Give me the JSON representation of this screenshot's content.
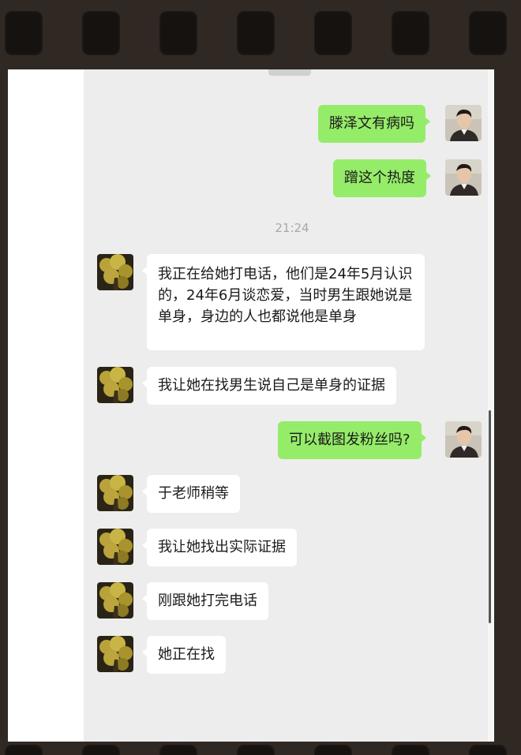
{
  "chat": {
    "timestamp": "21:24",
    "messages": [
      {
        "side": "out",
        "text": "滕泽文有病吗"
      },
      {
        "side": "out",
        "text": "蹭这个热度"
      },
      {
        "side": "in",
        "text": "我正在给她打电话，他们是24年5月认识的，24年6月谈恋爱，当时男生跟她说是单身，身边的人也都说他是单身"
      },
      {
        "side": "in",
        "text": "我让她在找男生说自己是单身的证据"
      },
      {
        "side": "out",
        "text": "可以截图发粉丝吗?"
      },
      {
        "side": "in",
        "text": "于老师稍等"
      },
      {
        "side": "in",
        "text": "我让她找出实际证据"
      },
      {
        "side": "in",
        "text": "刚跟她打完电话"
      },
      {
        "side": "in",
        "text": "她正在找"
      }
    ]
  },
  "colors": {
    "outgoing_bubble": "#95ec69",
    "incoming_bubble": "#ffffff",
    "chat_background": "#ededed",
    "timestamp_text": "#a8a8a8"
  },
  "icons": {
    "self_avatar": "man-portrait-avatar",
    "contact_avatar": "yellow-tree-night-avatar"
  }
}
